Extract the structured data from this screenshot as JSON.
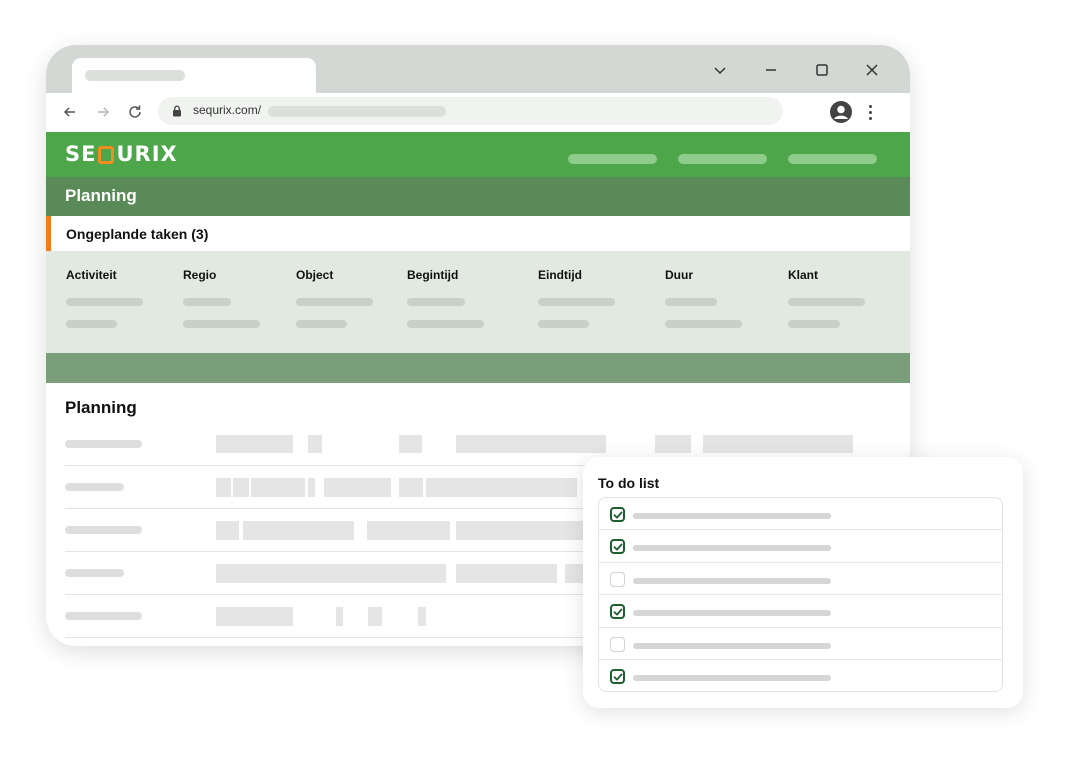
{
  "browser": {
    "url": "sequrix.com/",
    "controls": {
      "minimize_icon": "minimize-icon",
      "maximize_icon": "maximize-icon",
      "close_icon": "close-icon",
      "chevron_icon": "chevron-down-icon"
    }
  },
  "app": {
    "logo": {
      "text_before": "SE",
      "text_after": "URIX"
    },
    "header_title": "Planning",
    "unplanned_title": "Ongeplande taken (3)",
    "columns": [
      "Activiteit",
      "Regio",
      "Object",
      "Begintijd",
      "Eindtijd",
      "Duur",
      "Klant"
    ],
    "planning_title": "Planning"
  },
  "todo": {
    "title": "To do list",
    "items": [
      {
        "checked": true
      },
      {
        "checked": true
      },
      {
        "checked": false
      },
      {
        "checked": true
      },
      {
        "checked": false
      },
      {
        "checked": true
      }
    ]
  },
  "colors": {
    "brand_green": "#4ea64a",
    "dark_green": "#5a8a57",
    "accent_orange": "#f07d1a",
    "check_green": "#1f5e31"
  }
}
